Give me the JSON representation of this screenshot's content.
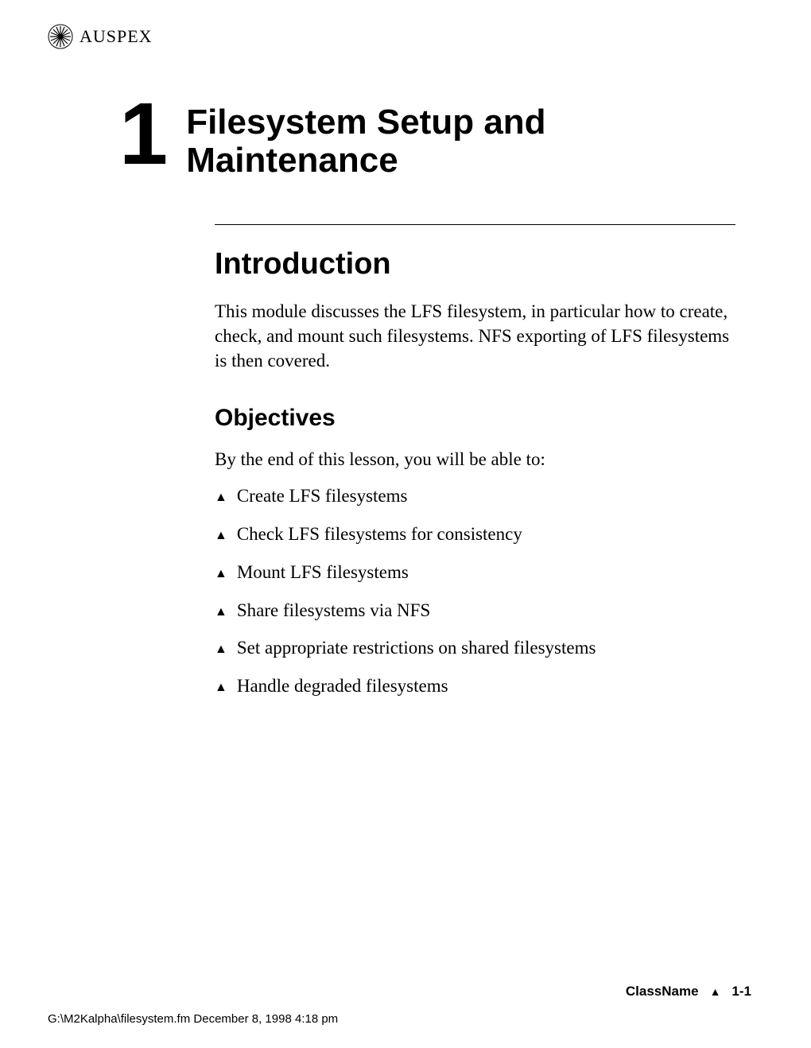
{
  "header": {
    "logo_text": "AUSPEX"
  },
  "chapter": {
    "number": "1",
    "title_line1": "Filesystem Setup and",
    "title_line2": "Maintenance"
  },
  "section_intro": {
    "heading": "Introduction",
    "body": "This module discusses the LFS filesystem, in particular how to create, check, and mount such filesystems. NFS exporting of LFS filesystems is then covered."
  },
  "section_objectives": {
    "heading": "Objectives",
    "intro": "By the end of this lesson, you will be able to:",
    "items": [
      "Create LFS filesystems",
      "Check LFS filesystems for consistency",
      "Mount LFS filesystems",
      "Share filesystems via NFS",
      "Set appropriate restrictions on shared filesystems",
      "Handle degraded filesystems"
    ]
  },
  "footer": {
    "classname": "ClassName",
    "pagenum": "1-1",
    "path": "G:\\M2Kalpha\\filesystem.fm    December 8, 1998 4:18 pm"
  }
}
